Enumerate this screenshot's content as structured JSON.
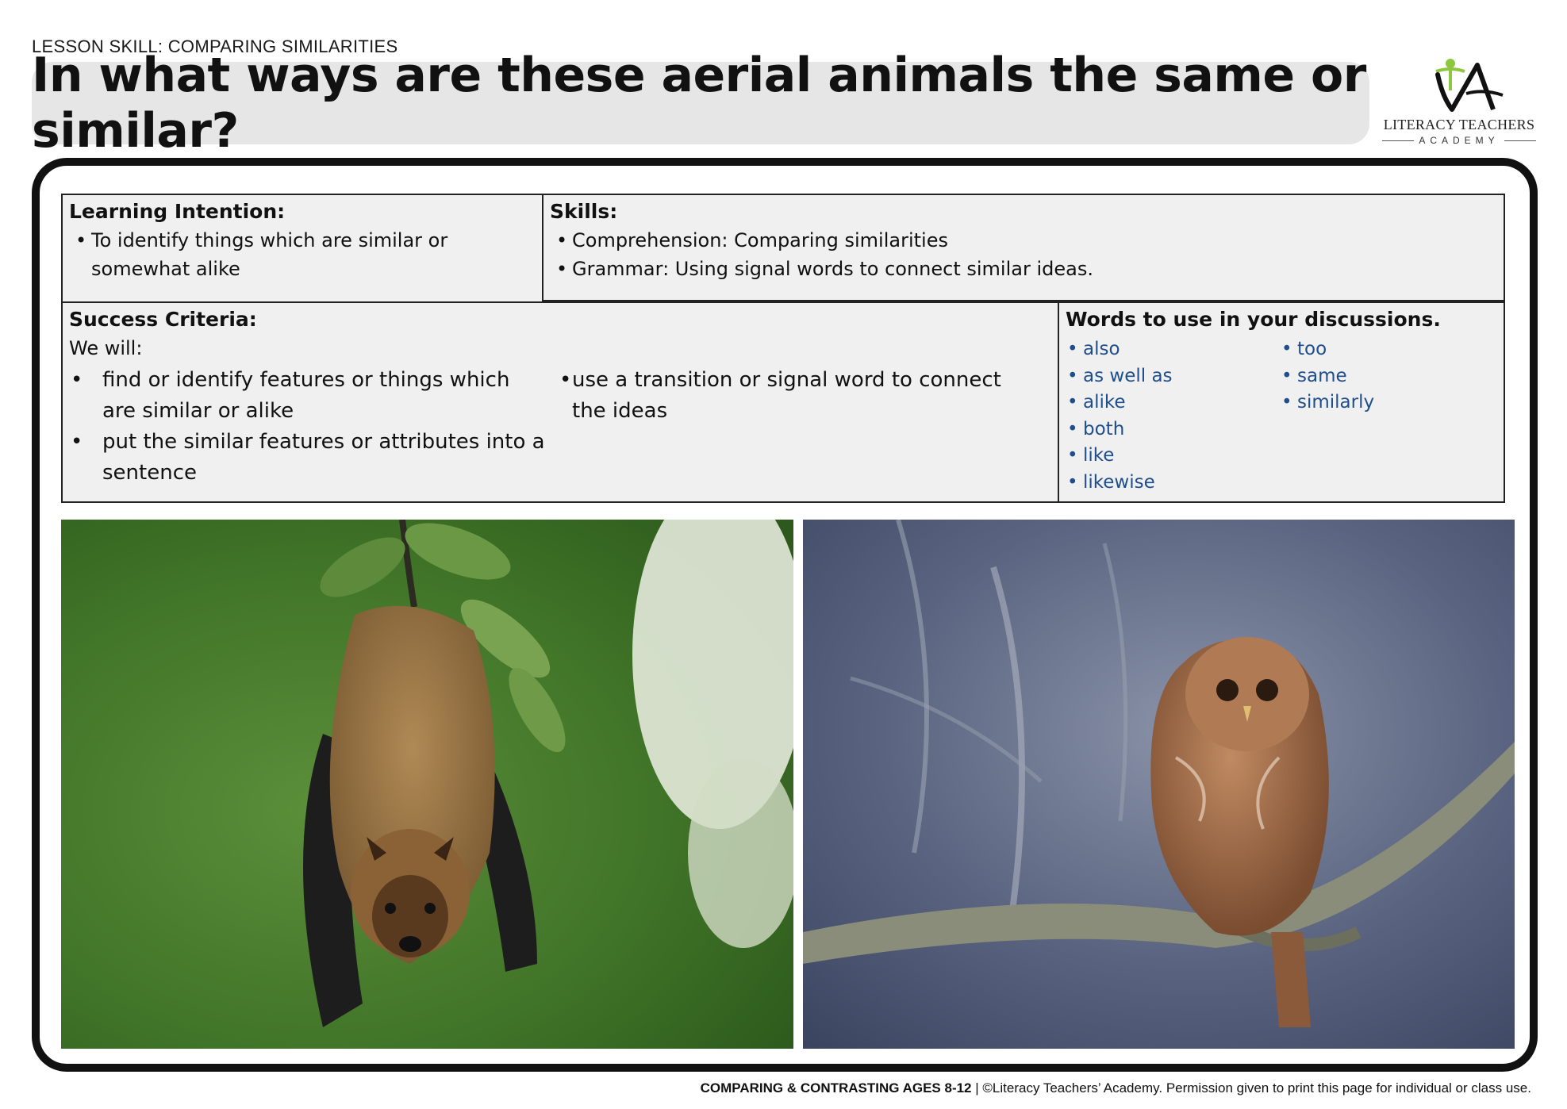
{
  "header": {
    "lesson_skill": "LESSON SKILL: COMPARING SIMILARITIES",
    "title": "In what ways are these aerial animals the same or similar?"
  },
  "logo": {
    "name": "LITERACY TEACHERS",
    "sub": "ACADEMY",
    "icon": "lta-logo-icon"
  },
  "learning_intention": {
    "heading": "Learning Intention:",
    "items": [
      "To identify things which are similar or somewhat alike"
    ]
  },
  "skills": {
    "heading": "Skills:",
    "items": [
      "Comprehension: Comparing similarities",
      "Grammar: Using signal words to connect similar ideas."
    ]
  },
  "success_criteria": {
    "heading": "Success Criteria:",
    "intro": "We will:",
    "left_items": [
      "find or identify features or things which are similar or alike",
      " put the similar features or attributes into a sentence"
    ],
    "right_items": [
      "use a transition or signal word to connect the ideas"
    ]
  },
  "words": {
    "heading": "Words to use in your discussions.",
    "column1": [
      "also",
      "as well as",
      "alike",
      "both",
      "like",
      "likewise"
    ],
    "column2": [
      "too",
      "same",
      "similarly"
    ],
    "color": "#1f4e8c"
  },
  "photos": {
    "left": "bat-photo",
    "right": "owl-photo"
  },
  "footer": {
    "bold": "COMPARING & CONTRASTING AGES 8-12",
    "separator": " | ",
    "rest": "©Literacy Teachers’ Academy. Permission given to print this page for individual or class use."
  }
}
